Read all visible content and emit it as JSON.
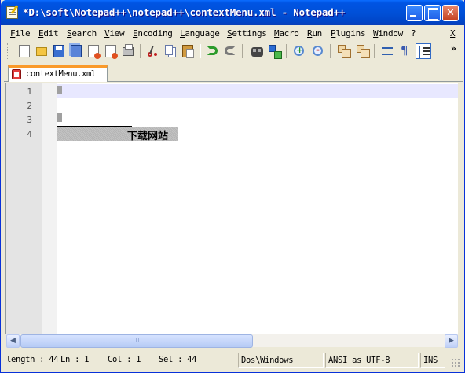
{
  "window": {
    "title": "*D:\\soft\\Notepad++\\notepad++\\contextMenu.xml - Notepad++",
    "colors": {
      "title_bar": "#0054e3",
      "tab_accent": "#fa9a2a",
      "current_line": "#e8e8ff",
      "close_button": "#c4401f"
    }
  },
  "menubar": {
    "items": [
      "File",
      "Edit",
      "Search",
      "View",
      "Encoding",
      "Language",
      "Settings",
      "Macro",
      "Run",
      "Plugins",
      "Window",
      "?"
    ],
    "close_label": "X"
  },
  "toolbar": {
    "icons": [
      "new-file-icon",
      "open-folder-icon",
      "save-icon",
      "save-all-icon",
      "close-file-icon",
      "close-all-icon",
      "print-icon",
      "cut-icon",
      "copy-icon",
      "paste-icon",
      "undo-icon",
      "redo-icon",
      "find-icon",
      "replace-icon",
      "zoom-in-icon",
      "zoom-out-icon",
      "sync-scroll-icon",
      "word-wrap-icon",
      "show-all-chars-icon",
      "indent-guide-icon"
    ],
    "overflow_label": "»"
  },
  "tabs": [
    {
      "label": "contextMenu.xml",
      "icon": "unsaved-file-icon",
      "active": true
    }
  ],
  "editor": {
    "line_numbers": [
      "1",
      "2",
      "3",
      "4"
    ],
    "lines": [
      "",
      "",
      "",
      "下载网站"
    ],
    "current_line": 1
  },
  "hscroll": {
    "thumb_label": "III"
  },
  "statusbar": {
    "length": "length : 44",
    "ln": "Ln : 1",
    "col": "Col : 1",
    "sel": "Sel : 44",
    "eol": "Dos\\Windows",
    "encoding": "ANSI as UTF-8",
    "mode": "INS"
  }
}
